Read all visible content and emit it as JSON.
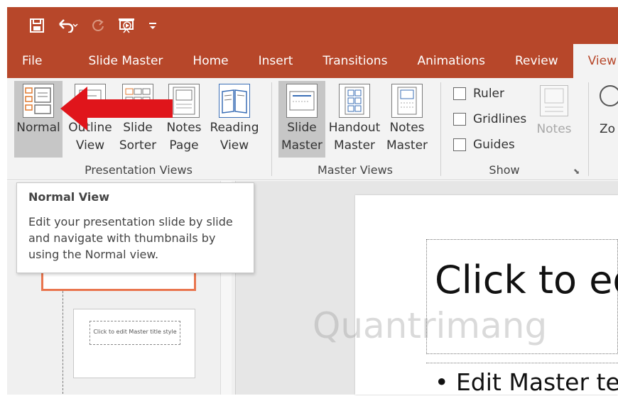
{
  "quick_access": {
    "save_icon": "save-icon",
    "undo_icon": "undo-icon",
    "redo_icon": "redo-icon",
    "present_icon": "present-from-beginning-icon",
    "customize_icon": "customize-qat-icon"
  },
  "tabs": [
    {
      "label": "File"
    },
    {
      "label": "Slide Master"
    },
    {
      "label": "Home"
    },
    {
      "label": "Insert"
    },
    {
      "label": "Transitions"
    },
    {
      "label": "Animations"
    },
    {
      "label": "Review"
    },
    {
      "label": "View",
      "active": true
    }
  ],
  "ribbon": {
    "presentation_views": {
      "label": "Presentation Views",
      "buttons": [
        {
          "line1": "Normal",
          "line2": ""
        },
        {
          "line1": "Outline",
          "line2": "View"
        },
        {
          "line1": "Slide",
          "line2": "Sorter"
        },
        {
          "line1": "Notes",
          "line2": "Page"
        },
        {
          "line1": "Reading",
          "line2": "View"
        }
      ]
    },
    "master_views": {
      "label": "Master Views",
      "buttons": [
        {
          "line1": "Slide",
          "line2": "Master"
        },
        {
          "line1": "Handout",
          "line2": "Master"
        },
        {
          "line1": "Notes",
          "line2": "Master"
        }
      ]
    },
    "show": {
      "label": "Show",
      "checkboxes": [
        {
          "label": "Ruler",
          "checked": false
        },
        {
          "label": "Gridlines",
          "checked": false
        },
        {
          "label": "Guides",
          "checked": false
        }
      ],
      "notes_label": "Notes"
    },
    "zoom_partial": "Zo"
  },
  "tooltip": {
    "title": "Normal View",
    "description": "Edit your presentation slide by slide and navigate with thumbnails by using the Normal view."
  },
  "slide": {
    "title_placeholder": "Click to ed",
    "body_placeholder": "• Edit Master te"
  },
  "thumbnail2": {
    "text": "Click to edit Master title style"
  },
  "watermark": "Quantrimang",
  "colors": {
    "accent": "#b7472a",
    "ribbon_bg": "#f3f3f3",
    "arrow": "#e0151b"
  }
}
